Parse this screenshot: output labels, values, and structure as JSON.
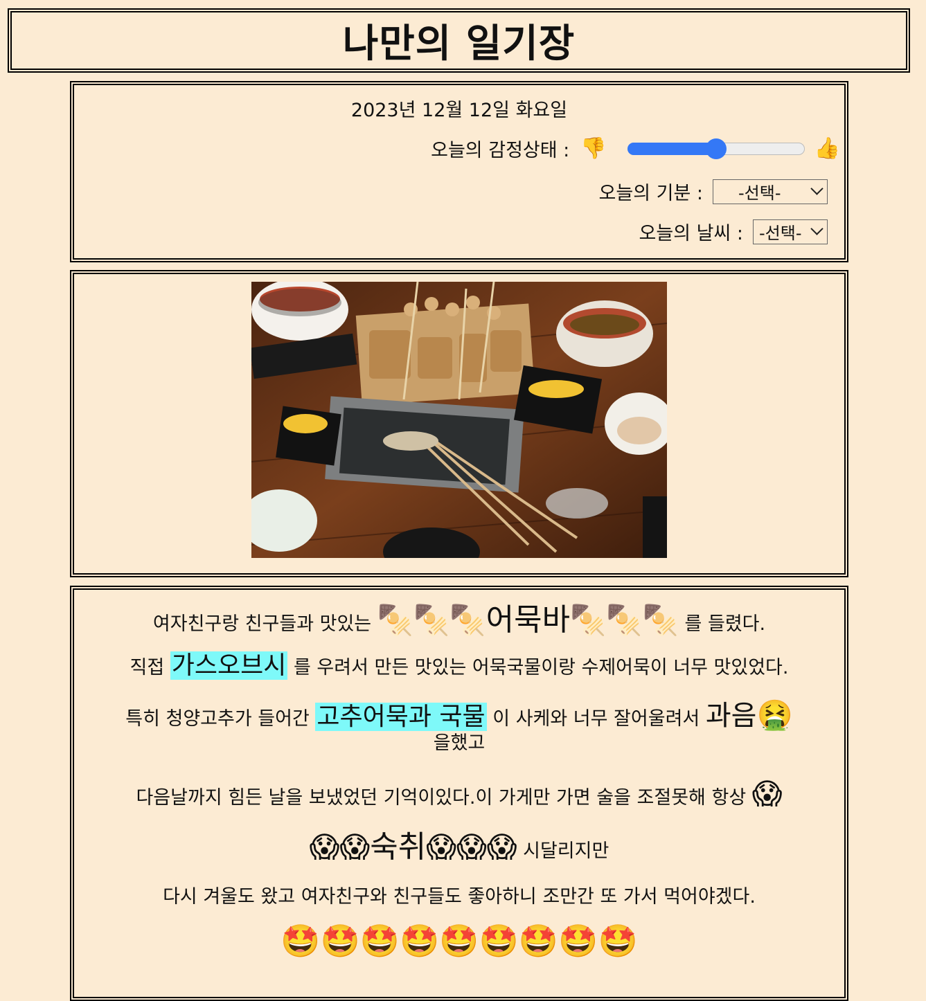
{
  "header": {
    "title": "나만의 일기장"
  },
  "info": {
    "date": "2023년 12월 12일 화요일",
    "emotion": {
      "label": "오늘의 감정상태 :",
      "down_icon": "thumbs-down-icon",
      "up_icon": "thumbs-up-icon",
      "down_glyph": "👎",
      "up_glyph": "👍",
      "value_fraction": 0.5
    },
    "mood": {
      "label": "오늘의 기분 :",
      "selected": "-선택-"
    },
    "weather": {
      "label": "오늘의 날씨 :",
      "selected": "-선택-"
    }
  },
  "entry": {
    "p1_a": "여자친구랑 친구들과 맛있는 ",
    "oden_left": "🍢🍢🍢",
    "p1_big": "어묵바",
    "oden_right": "🍢🍢🍢",
    "p1_b": " 를 들렸다.",
    "p2_a": "직접 ",
    "p2_hl": "가스오브시",
    "p2_b": " 를 우려서 만든 맛있는 어묵국물이랑 수제어묵이 너무 맛있었다.",
    "p3_a": "특히 청양고추가 들어간  ",
    "p3_hl": "고추어묵과 국물",
    "p3_b": " 이 사케와 너무 잘어울려서 ",
    "p3_big": "과음",
    "p3_emo": "🤮",
    "p3_c": "을했고",
    "p4_a": "다음날까지 힘든 날을 보냈었던 기억이있다.이 가게만 가면 술을 조절못해 항상 ",
    "p4_emo": "😱",
    "p5_emo_left": "😱😱",
    "p5_big": "숙취",
    "p5_emo_right": "😱😱😱",
    "p5_b": " 시달리지만",
    "p6": "다시 겨울도 왔고 여자친구와 친구들도 좋아하니 조만간 또 가서 먹어야겠다.",
    "p7_emo": "🤩🤩🤩🤩🤩🤩🤩🤩🤩"
  },
  "colors": {
    "background": "#fcebd3",
    "slider": "#3478f6",
    "highlight": "#7ef9f9"
  }
}
